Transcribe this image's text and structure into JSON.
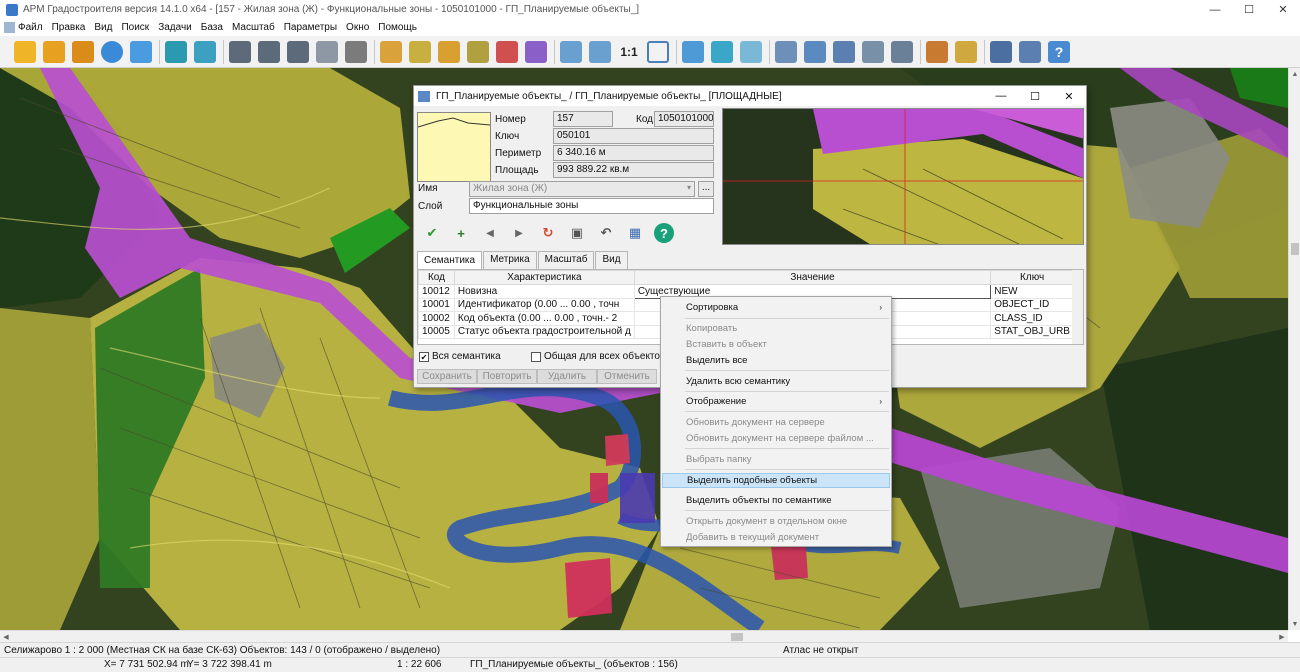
{
  "window": {
    "title": "АРМ Градостроителя версия 14.1.0 x64 - [157 - Жилая зона (Ж) - Функциональные зоны - 1050101000 - ГП_Планируемые объекты_]",
    "min": "—",
    "max": "☐",
    "close": "✕"
  },
  "menu": [
    "Файл",
    "Правка",
    "Вид",
    "Поиск",
    "Задачи",
    "База",
    "Масштаб",
    "Параметры",
    "Окно",
    "Помощь"
  ],
  "toolbar": {
    "scale_label": "1:1"
  },
  "dialog": {
    "title": "ГП_Планируемые объекты_ / ГП_Планируемые объекты_ [ПЛОЩАДНЫЕ]",
    "min": "—",
    "max": "☐",
    "close": "✕",
    "nomer_label": "Номер",
    "nomer_value": "157",
    "kod_label": "Код",
    "kod_value": "1050101000",
    "kluch_label": "Ключ",
    "kluch_value": "050101",
    "perimetr_label": "Периметр",
    "perimetr_value": "6 340.16 м",
    "ploshad_label": "Площадь",
    "ploshad_value": "993 889.22 кв.м",
    "imya_label": "Имя",
    "imya_value": "Жилая зона (Ж)",
    "sloy_label": "Слой",
    "sloy_value": "Функциональные зоны",
    "browse": "...",
    "tabs": [
      "Семантика",
      "Метрика",
      "Масштаб",
      "Вид"
    ],
    "grid": {
      "headers": [
        "Код",
        "Характеристика",
        "Значение",
        "Ключ"
      ],
      "rows": [
        {
          "kod": "10012",
          "har": "Новизна",
          "val": "Существующие",
          "key": "NEW"
        },
        {
          "kod": "10001",
          "har": "Идентификатор  (0.00 ... 0.00 , точн",
          "val": "",
          "key": "OBJECT_ID"
        },
        {
          "kod": "10002",
          "har": "Код объекта  (0.00 ... 0.00 , точн.- 2",
          "val": "",
          "key": "CLASS_ID"
        },
        {
          "kod": "10005",
          "har": "Статус объекта градостроительной д",
          "val": "",
          "key": "STAT_OBJ_URB"
        }
      ]
    },
    "check_all": "Вся семантика",
    "check_common": "Общая для всех объектов",
    "btn_save": "Сохранить",
    "btn_restore": "Повторить",
    "btn_delete": "Удалить",
    "btn_cancel": "Отменить"
  },
  "context_menu": {
    "sort": "Сортировка",
    "copy": "Копировать",
    "paste": "Вставить в объект",
    "select_all": "Выделить все",
    "delete_all": "Удалить всю семантику",
    "display": "Отображение",
    "update_server": "Обновить документ на сервере",
    "update_server_file": "Обновить документ на сервере файлом ...",
    "choose_folder": "Выбрать папку",
    "select_similar": "Выделить подобные объекты",
    "select_by_sem": "Выделить объекты по семантике",
    "open_window": "Открыть документ в отдельном окне",
    "add_current": "Добавить в текущий документ"
  },
  "status": {
    "left": "Селижарово   1 : 2 000 (Местная СК на базе СК-63)  Объектов: 143 / 0 (отображено / выделено)",
    "atlas": "Атлас не открыт",
    "x": "X= 7 731 502.94 m",
    "y": "Y= 3 722 398.41 m",
    "scale": "1 : 22 606",
    "layer": "ГП_Планируемые объекты_  (объектов : 156)"
  }
}
